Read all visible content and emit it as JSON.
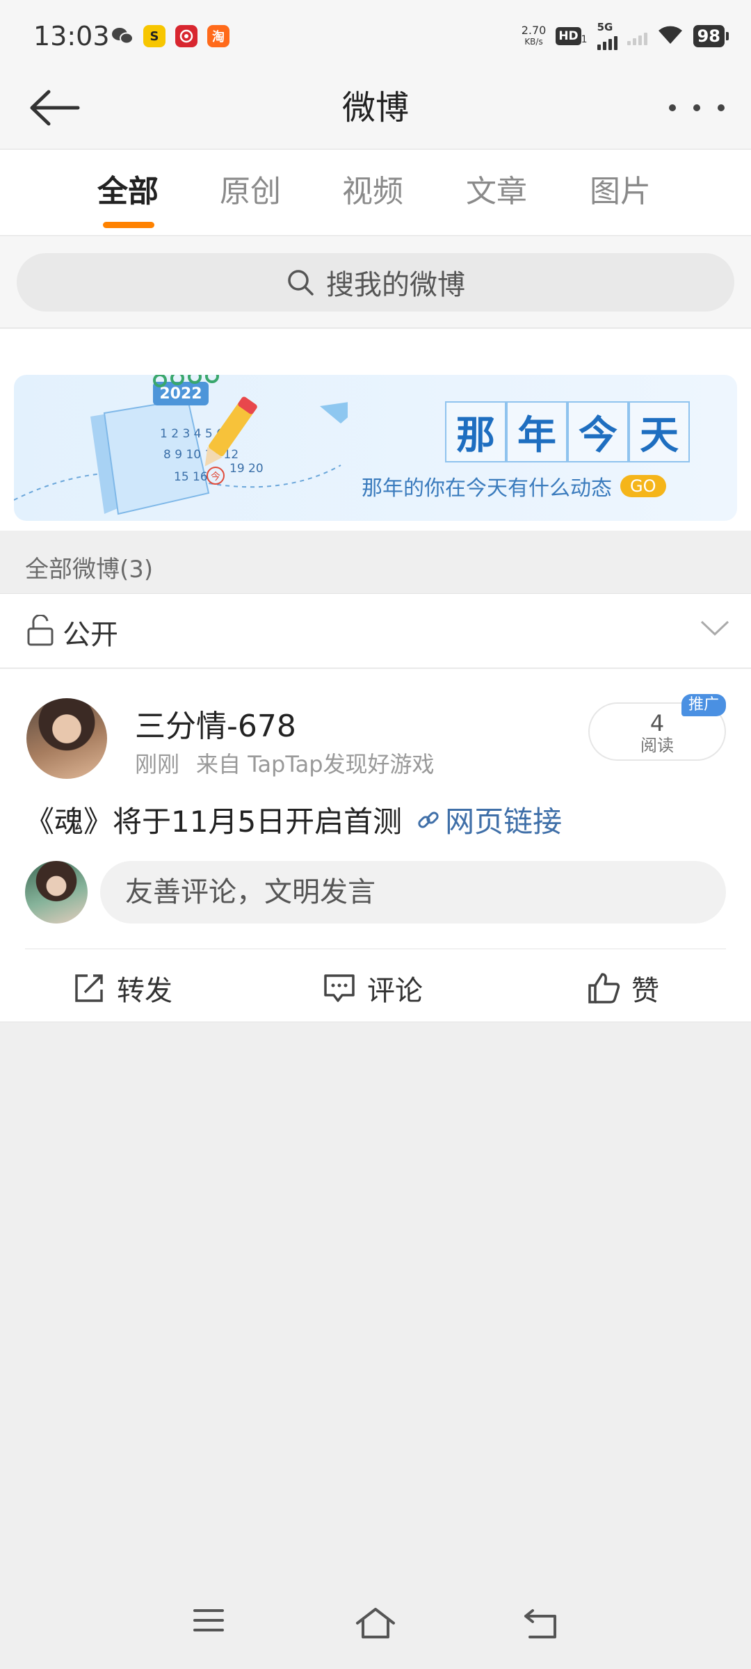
{
  "status_bar": {
    "time": "13:03",
    "net_speed_value": "2.70",
    "net_speed_unit": "KB/s",
    "hd_label": "HD",
    "hd_sub": "1",
    "network_type": "5G",
    "battery": "98",
    "app_icons": [
      "wechat-icon",
      "sogou-icon",
      "netease-music-icon",
      "taobao-icon"
    ]
  },
  "nav": {
    "title": "微博"
  },
  "tabs": [
    {
      "label": "全部",
      "active": true
    },
    {
      "label": "原创",
      "active": false
    },
    {
      "label": "视频",
      "active": false
    },
    {
      "label": "文章",
      "active": false
    },
    {
      "label": "图片",
      "active": false
    }
  ],
  "search": {
    "placeholder": "搜我的微博"
  },
  "banner": {
    "year_badge": "2022",
    "calendar_numbers": "1 2 3 4 5 6 / 8 9 10 11 12 / 15 16 今 19 20",
    "title_chars": [
      "那",
      "年",
      "今",
      "天"
    ],
    "subtitle": "那年的你在今天有什么动态",
    "cta": "GO"
  },
  "section": {
    "header": "全部微博(3)"
  },
  "filter": {
    "label": "公开"
  },
  "post": {
    "username": "三分情-678",
    "time": "刚刚",
    "source": "来自 TapTap发现好游戏",
    "read_count": "4",
    "read_label": "阅读",
    "badge": "推广",
    "text": "《魂》将于11月5日开启首测",
    "link_text": "网页链接",
    "comment_placeholder": "友善评论，文明发言",
    "actions": {
      "repost": "转发",
      "comment": "评论",
      "like": "赞"
    }
  },
  "colors": {
    "accent": "#ff8200",
    "link": "#3f6fa8",
    "banner_blue": "#1e6ec0",
    "go_yellow": "#f5b51a",
    "badge_blue": "#4a90e2"
  }
}
